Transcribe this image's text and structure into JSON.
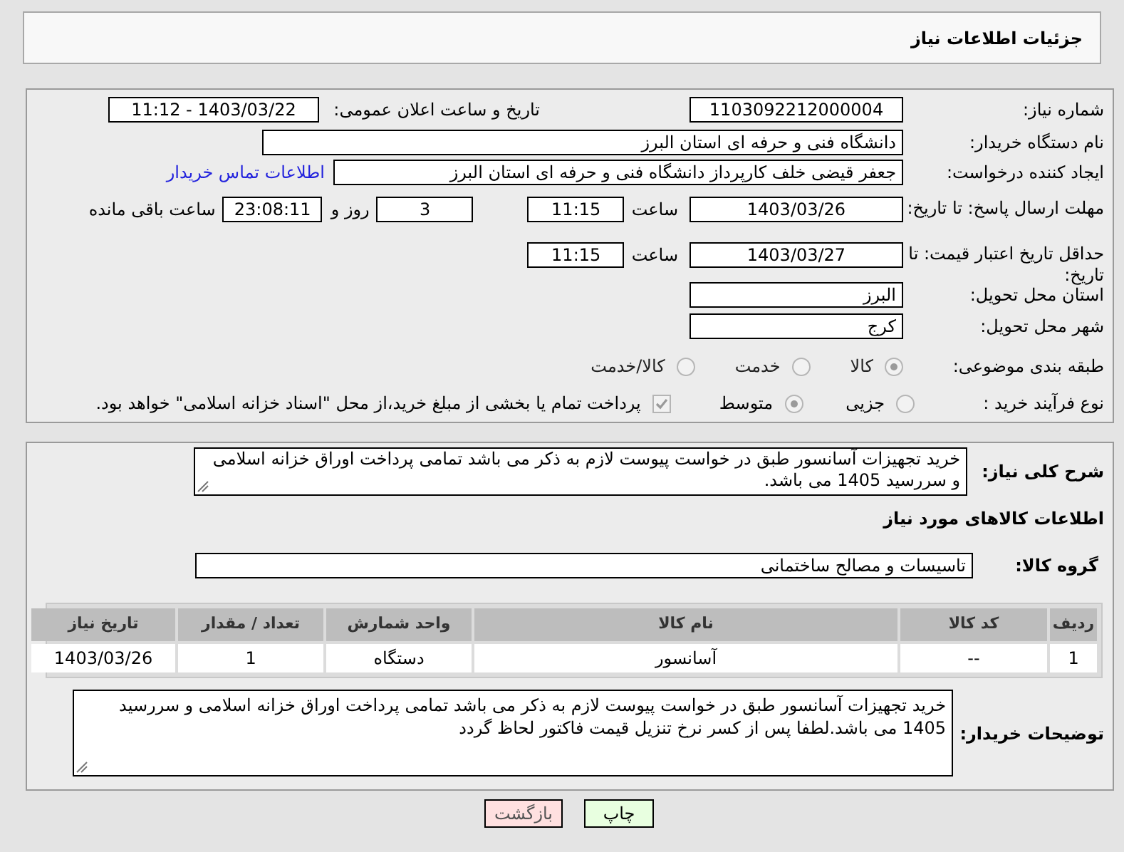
{
  "header": {
    "title": "جزئیات اطلاعات نیاز"
  },
  "need_number": {
    "label": "شماره نیاز:",
    "value": "1103092212000004"
  },
  "announcement": {
    "label": "تاریخ و ساعت اعلان عمومی:",
    "value": "1403/03/22 - 11:12"
  },
  "buyer_org": {
    "label": "نام دستگاه خریدار:",
    "value": "دانشگاه فنی و حرفه ای استان البرز"
  },
  "requester": {
    "label": "ایجاد کننده درخواست:",
    "value": "جعفر قیضی خلف کارپرداز دانشگاه فنی و حرفه ای استان البرز",
    "contact_link": "اطلاعات تماس خریدار"
  },
  "response_deadline": {
    "label": "مهلت ارسال پاسخ: تا تاریخ:",
    "date": "1403/03/26",
    "time_label": "ساعت",
    "time": "11:15",
    "days": "3",
    "days_label": "روز و",
    "remaining": "23:08:11",
    "remaining_label": "ساعت باقی مانده"
  },
  "price_validity": {
    "label": "حداقل تاریخ اعتبار قیمت: تا تاریخ:",
    "date": "1403/03/27",
    "time_label": "ساعت",
    "time": "11:15"
  },
  "province": {
    "label": "استان محل تحویل:",
    "value": "البرز"
  },
  "city": {
    "label": "شهر محل تحویل:",
    "value": "کرج"
  },
  "category": {
    "label": "طبقه بندی موضوعی:",
    "options": [
      {
        "label": "کالا",
        "selected": true
      },
      {
        "label": "خدمت",
        "selected": false
      },
      {
        "label": "کالا/خدمت",
        "selected": false
      }
    ]
  },
  "purchase_type": {
    "label": "نوع فرآیند خرید :",
    "options": [
      {
        "label": "جزیی",
        "selected": false
      },
      {
        "label": "متوسط",
        "selected": true
      }
    ],
    "payment_option": {
      "label": "پرداخت تمام یا بخشی از مبلغ خرید،از محل \"اسناد خزانه اسلامی\" خواهد بود.",
      "checked": true
    }
  },
  "description": {
    "label": "شرح کلی نیاز:",
    "value": "خرید تجهیزات آسانسور طبق در خواست پیوست لازم به ذکر می باشد تمامی پرداخت اوراق خزانه اسلامی و سررسید 1405 می باشد."
  },
  "goods_heading": "اطلاعات کالاهای مورد نیاز",
  "goods_group": {
    "label": "گروه کالا:",
    "value": "تاسیسات و مصالح ساختمانی"
  },
  "table": {
    "columns": [
      "ردیف",
      "کد کالا",
      "نام کالا",
      "واحد شمارش",
      "تعداد / مقدار",
      "تاریخ نیاز"
    ],
    "rows": [
      [
        "1",
        "--",
        "آسانسور",
        "دستگاه",
        "1",
        "1403/03/26"
      ]
    ]
  },
  "buyer_notes": {
    "label": "توضیحات خریدار:",
    "value": "خرید تجهیزات آسانسور طبق در خواست پیوست لازم به ذکر می باشد تمامی پرداخت اوراق خزانه اسلامی و سررسید 1405 می باشد.لطفا پس از کسر نرخ تنزیل قیمت فاکتور لحاظ گردد"
  },
  "buttons": [
    {
      "label": "چاپ",
      "kind": "print"
    },
    {
      "label": "بازگشت",
      "kind": "back"
    }
  ]
}
